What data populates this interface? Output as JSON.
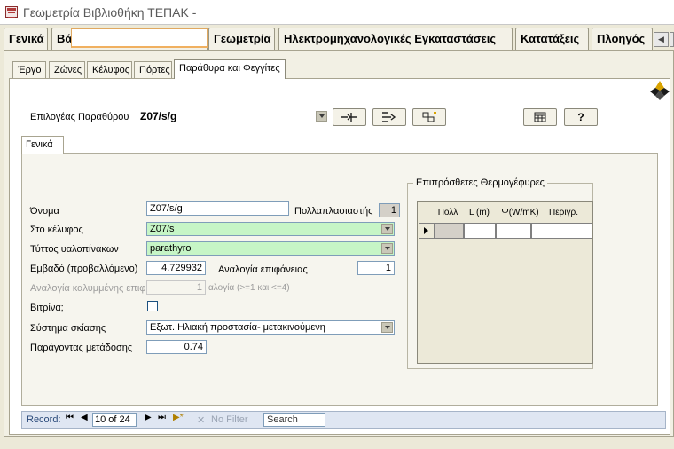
{
  "window": {
    "title": "Γεωμετρία Βιβλιοθήκη ΤΕΠΑΚ -"
  },
  "top_tabs": [
    "Γενικά",
    "Βά",
    "Γεωμετρία",
    "Ηλεκτρομηχανολογικές Εγκαταστάσεις",
    "Κατατάξεις",
    "Πλοηγός"
  ],
  "sub_tabs": [
    "Έργο",
    "Ζώνες",
    "Κέλυφος",
    "Πόρτες",
    "Παράθυρα και Φεγγίτες"
  ],
  "selector": {
    "label": "Επιλογέας Παραθύρου",
    "value": "Z07/s/g"
  },
  "toolbar_icons": [
    "link-window-icon",
    "export-arrow-icon",
    "duplicate-window-icon",
    "calculator-icon",
    "help-icon"
  ],
  "inner_tab": "Γενικά",
  "form": {
    "name_label": "Όνομα",
    "name_value": "Z07/s/g",
    "multiplicity_label": "Πολλαπλασιαστής",
    "multiplicity_value": "1",
    "shell_label": "Στο κέλυφος",
    "shell_value": "Z07/s",
    "glazing_label": "Τύττος υαλοπίνακων",
    "glazing_value": "parathyro",
    "area_label": "Εμβαδό (προβαλλόμενο)",
    "area_value": "4.729932",
    "surface_ratio_label": "Αναλογία επιφάνειας",
    "surface_ratio_value": "1",
    "covered_ratio_label": "Αναλογία καλυμμένης επιφ",
    "covered_ratio_value": "1",
    "covered_ratio_hint": "αλογία (>=1 και <=4)",
    "vitrine_label": "Βιτρίνα;",
    "shading_label": "Σύστημα σκίασης",
    "shading_value": "Εξωτ. Ηλιακή προστασία- μετακινούμενη",
    "transfer_label": "Παράγοντας μετάδοσης",
    "transfer_value": "0.74"
  },
  "thermal_bridges": {
    "title": "Επιπρόσθετες Θερμογέφυρες",
    "columns": [
      "Πολλ",
      "L (m)",
      "Ψ(W/mK)",
      "Περιγρ."
    ]
  },
  "record_nav": {
    "label": "Record:",
    "position": "10 of 24",
    "filter": "No Filter",
    "search": "Search"
  },
  "colors": {
    "accent_green": "#c6f5c6",
    "panel_bg": "#f6f5ee"
  }
}
